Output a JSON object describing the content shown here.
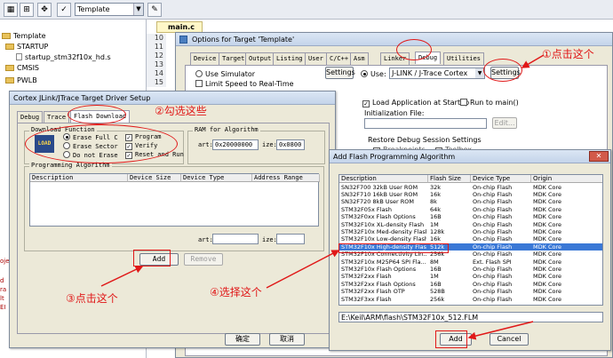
{
  "toolbar": {
    "target": "Template"
  },
  "editor": {
    "tab": "main.c",
    "lines": [
      "10",
      "11",
      "12",
      "13",
      "14",
      "15"
    ]
  },
  "project": {
    "root": "Template",
    "items": [
      "STARTUP",
      "startup_stm32f10x_hd.s",
      "CMSIS",
      "PWLB"
    ]
  },
  "output_panel": {
    "lines": [
      "ojec",
      "d",
      "ra",
      "lt",
      "EI"
    ]
  },
  "options_dialog": {
    "title": "Options for Target 'Template'",
    "tabs": [
      "Device",
      "Target",
      "Output",
      "Listing",
      "User",
      "C/C++",
      "Asm",
      "Linker",
      "Debug",
      "Utilities"
    ],
    "use_simulator": "Use Simulator",
    "limit_speed": "Limit Speed to Real-Time",
    "settings_left": "Settings",
    "use_label": "Use:",
    "debugger": "J-LINK / J-Trace Cortex",
    "settings_right": "Settings",
    "load_app": "Load Application at Startup",
    "run_to_main": "Run to main()",
    "init_file": "Initialization File:",
    "edit_btn": "Edit...",
    "restore": "Restore Debug Session Settings",
    "breakpoints": "Breakpoints",
    "toolbox": "Toolbox"
  },
  "jlink_dialog": {
    "title": "Cortex JLink/JTrace Target Driver Setup",
    "tabs": [
      "Debug",
      "Trace",
      "Flash Download"
    ],
    "download_function": "Download Function",
    "logo": "LOAD",
    "erase_full": "Erase Full C",
    "erase_sector": "Erase Sector",
    "no_erase": "Do not Erase",
    "program": "Program",
    "verify": "Verify",
    "reset_run": "Reset and Run",
    "ram_group": "RAM for Algorithm",
    "start_label": "art:",
    "start_value": "0x20000000",
    "size_label": "ize:",
    "size_value": "0x0800",
    "prog_algo": "Programming Algorithm",
    "cols": [
      "Description",
      "Device Size",
      "Device Type",
      "Address Range"
    ],
    "start2": "art:",
    "size2": "ize:",
    "add_btn": "Add",
    "remove_btn": "Remove",
    "ok_btn": "确定",
    "cancel_btn": "取消"
  },
  "add_dialog": {
    "title": "Add Flash Programming Algorithm",
    "cols": [
      "Description",
      "Flash Size",
      "Device Type",
      "Origin"
    ],
    "rows": [
      [
        "SN32F700 32kB User ROM",
        "32k",
        "On-chip Flash",
        "MDK Core"
      ],
      [
        "SN32F710 16kB User ROM",
        "16k",
        "On-chip Flash",
        "MDK Core"
      ],
      [
        "SN32F720 8kB User ROM",
        "8k",
        "On-chip Flash",
        "MDK Core"
      ],
      [
        "STM32F05x Flash",
        "64k",
        "On-chip Flash",
        "MDK Core"
      ],
      [
        "STM32F0xx Flash Options",
        "16B",
        "On-chip Flash",
        "MDK Core"
      ],
      [
        "STM32F10x XL-density Flash",
        "1M",
        "On-chip Flash",
        "MDK Core"
      ],
      [
        "STM32F10x Med-density Flash",
        "128k",
        "On-chip Flash",
        "MDK Core"
      ],
      [
        "STM32F10x Low-density Flash",
        "16k",
        "On-chip Flash",
        "MDK Core"
      ],
      [
        "STM32F10x High-density Flash",
        "512k",
        "On-chip Flash",
        "MDK Core"
      ],
      [
        "STM32F10x Connectivity Lin...",
        "256k",
        "On-chip Flash",
        "MDK Core"
      ],
      [
        "STM32F10x M25P64 SPI Fla...",
        "8M",
        "Ext. Flash SPI",
        "MDK Core"
      ],
      [
        "STM32F10x Flash Options",
        "16B",
        "On-chip Flash",
        "MDK Core"
      ],
      [
        "STM32F2xx Flash",
        "1M",
        "On-chip Flash",
        "MDK Core"
      ],
      [
        "STM32F2xx Flash Options",
        "16B",
        "On-chip Flash",
        "MDK Core"
      ],
      [
        "STM32F2xx Flash OTP",
        "528B",
        "On-chip Flash",
        "MDK Core"
      ],
      [
        "STM32F3xx Flash",
        "256k",
        "On-chip Flash",
        "MDK Core"
      ]
    ],
    "selected_row": 8,
    "path": "E:\\Keil\\ARM\\flash\\STM32F10x_512.FLM",
    "add_btn": "Add",
    "cancel_btn": "Cancel"
  },
  "annotations": {
    "step1": "①点击这个",
    "step2": "②勾选这些",
    "step3": "③点击这个",
    "step4": "④选择这个"
  },
  "colors": {
    "annotation": "#e01818",
    "selected_row": "#3a78d6"
  }
}
